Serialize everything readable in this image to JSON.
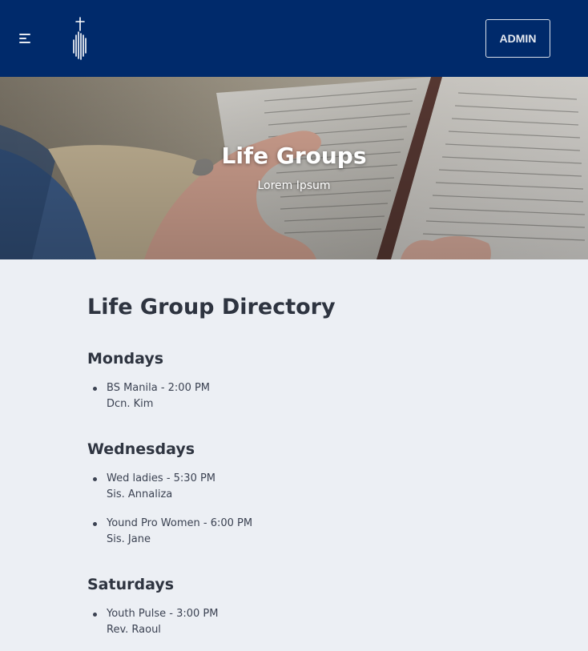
{
  "navbar": {
    "menu_icon": "hamburger-menu-icon",
    "logo_icon": "church-cross-logo-icon",
    "admin_label": "ADMIN",
    "background": "#002a6b"
  },
  "hero": {
    "title": "Life Groups",
    "subtitle": "Lorem Ipsum"
  },
  "directory": {
    "title": "Life Group Directory",
    "days": [
      {
        "name": "Mondays",
        "groups": [
          {
            "name_time": "BS Manila - 2:00 PM",
            "leader": "Dcn. Kim"
          }
        ]
      },
      {
        "name": "Wednesdays",
        "groups": [
          {
            "name_time": "Wed ladies - 5:30 PM",
            "leader": "Sis. Annaliza"
          },
          {
            "name_time": "Yound Pro Women - 6:00 PM",
            "leader": "Sis. Jane"
          }
        ]
      },
      {
        "name": "Saturdays",
        "groups": [
          {
            "name_time": "Youth Pulse - 3:00 PM",
            "leader": "Rev. Raoul"
          }
        ]
      }
    ]
  }
}
